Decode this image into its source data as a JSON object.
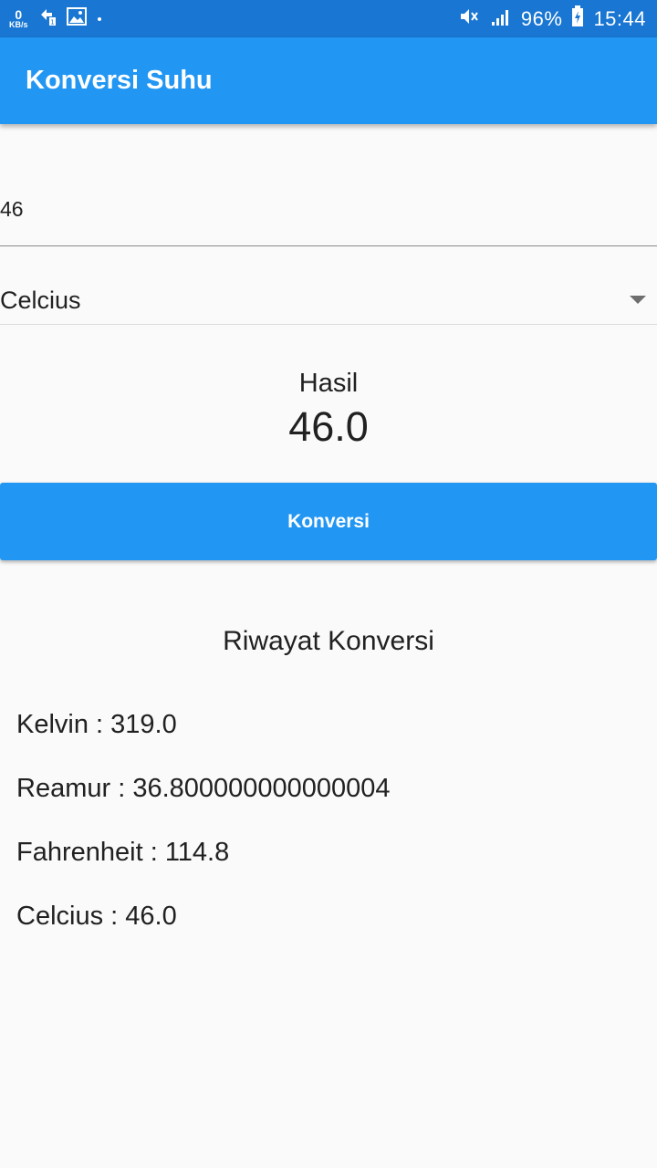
{
  "status_bar": {
    "speed_value": "0",
    "speed_unit": "KB/s",
    "battery": "96%",
    "time": "15:44",
    "icons": [
      "data-transfer-icon",
      "image-icon",
      "dot-icon",
      "mute-icon",
      "signal-icon",
      "battery-charging-icon"
    ]
  },
  "app_bar": {
    "title": "Konversi Suhu"
  },
  "input": {
    "value": "46"
  },
  "dropdown": {
    "selected": "Celcius"
  },
  "result": {
    "label": "Hasil",
    "value": "46.0"
  },
  "button": {
    "label": "Konversi"
  },
  "history": {
    "title": "Riwayat Konversi",
    "items": [
      "Kelvin : 319.0",
      "Reamur : 36.800000000000004",
      "Fahrenheit : 114.8",
      "Celcius : 46.0"
    ]
  },
  "colors": {
    "status_bar": "#1976d2",
    "primary": "#2196f3",
    "background": "#fafafa",
    "text": "#212121"
  }
}
